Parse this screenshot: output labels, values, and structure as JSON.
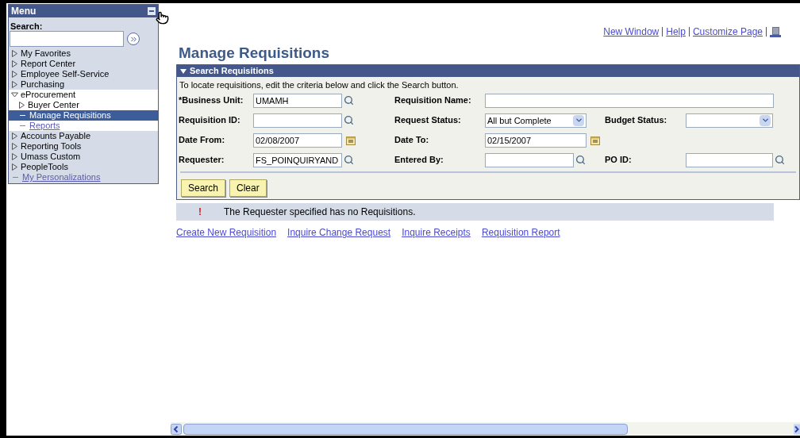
{
  "menu": {
    "title": "Menu",
    "search_label": "Search:",
    "items": [
      {
        "kind": "folder",
        "label": "My Favorites",
        "expanded": false,
        "selected": false
      },
      {
        "kind": "folder",
        "label": "Report Center",
        "expanded": false,
        "selected": false
      },
      {
        "kind": "folder",
        "label": "Employee Self-Service",
        "expanded": false,
        "selected": false
      },
      {
        "kind": "folder",
        "label": "Purchasing",
        "expanded": false,
        "selected": false
      },
      {
        "kind": "folder",
        "label": "eProcurement",
        "expanded": true,
        "selected": false,
        "children": [
          {
            "kind": "folder",
            "label": "Buyer Center",
            "expanded": false,
            "selected": false
          },
          {
            "kind": "leaf",
            "label": "Manage Requisitions",
            "selected": true
          },
          {
            "kind": "leaf",
            "label": "Reports",
            "selected": false
          }
        ]
      },
      {
        "kind": "folder",
        "label": "Accounts Payable",
        "expanded": false,
        "selected": false
      },
      {
        "kind": "folder",
        "label": "Reporting Tools",
        "expanded": false,
        "selected": false
      },
      {
        "kind": "folder",
        "label": "Umass Custom",
        "expanded": false,
        "selected": false
      },
      {
        "kind": "folder",
        "label": "PeopleTools",
        "expanded": false,
        "selected": false
      },
      {
        "kind": "leaf",
        "label": "My Personalizations",
        "selected": false
      }
    ]
  },
  "header_links": [
    "New Window",
    "Help",
    "Customize Page"
  ],
  "page_title": "Manage Requisitions",
  "search_panel": {
    "title": "Search Requisitions",
    "instructions": "To locate requisitions, edit the criteria below and click the Search button.",
    "rows": [
      [
        {
          "label": "*Business Unit:",
          "kind": "lookup",
          "value": "UMAMH"
        },
        {
          "label": "Requisition Name:",
          "kind": "wide"
        }
      ],
      [
        {
          "label": "Requisition ID:",
          "kind": "lookup"
        },
        {
          "label": "Request Status:",
          "kind": "select",
          "value": "All but Complete"
        },
        {
          "label": "Budget Status:",
          "kind": "select"
        }
      ],
      [
        {
          "label": "Date From:",
          "kind": "date",
          "value": "02/08/2007"
        },
        {
          "label": "Date To:",
          "kind": "date",
          "value": "02/15/2007"
        }
      ],
      [
        {
          "label": "Requester:",
          "kind": "lookup",
          "value": "FS_POINQUIRYAND"
        },
        {
          "label": "Entered By:",
          "kind": "lookup"
        },
        {
          "label": "PO ID:",
          "kind": "lookup"
        }
      ]
    ],
    "buttons": [
      "Search",
      "Clear"
    ]
  },
  "message": {
    "mark": "!",
    "text": "The Requester specified has no Requisitions."
  },
  "action_links": [
    "Create New Requisition",
    "Inquire Change Request",
    "Inquire Receipts",
    "Requisition Report"
  ]
}
